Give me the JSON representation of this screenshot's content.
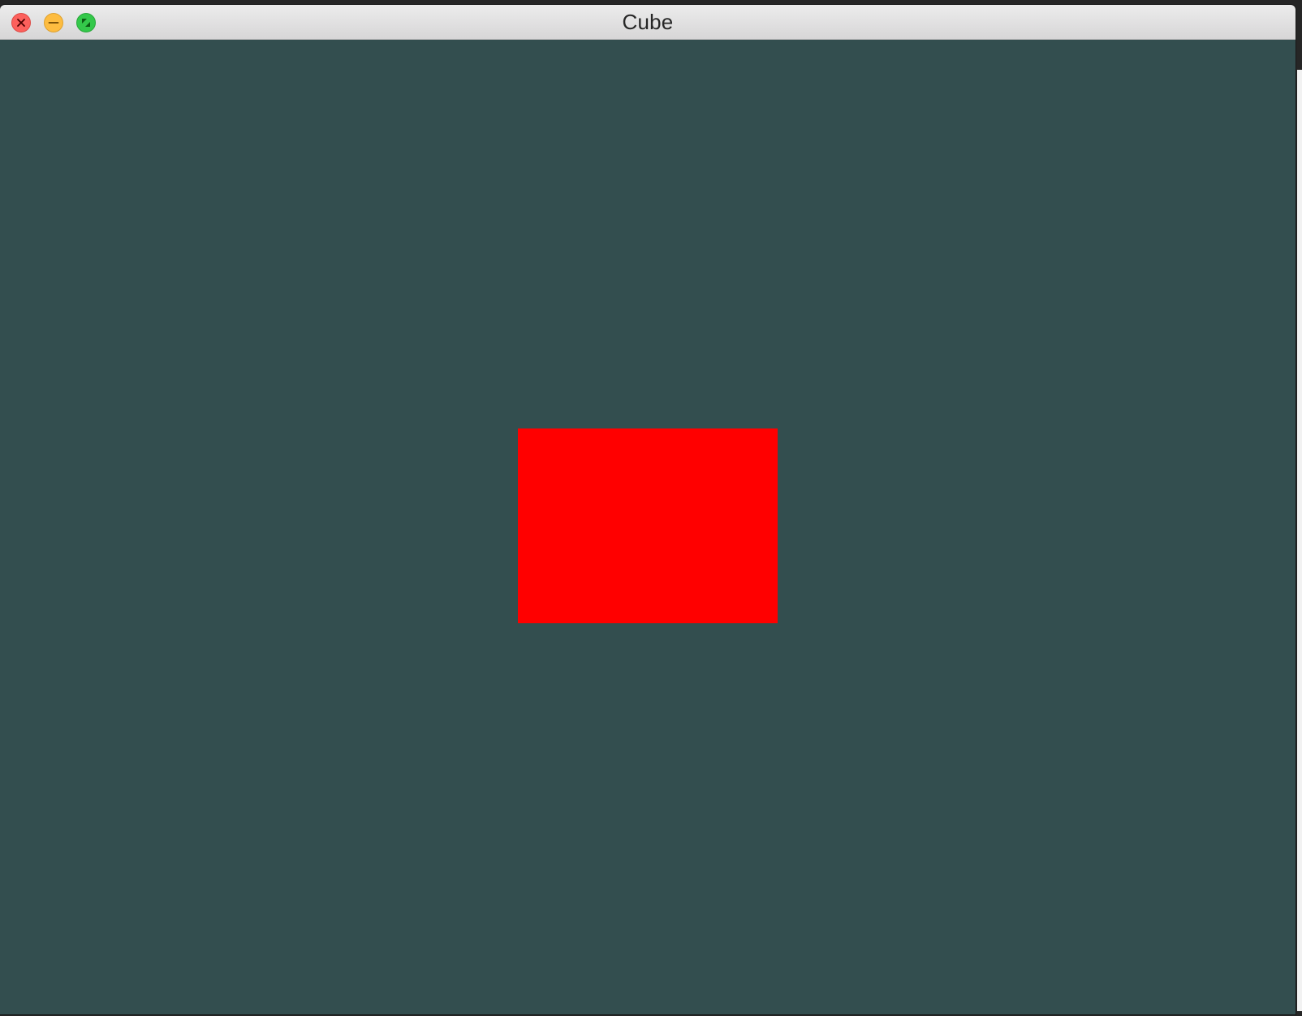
{
  "window": {
    "title": "Cube"
  },
  "controls": {
    "close_icon": "close-icon",
    "minimize_icon": "minimize-icon",
    "zoom_icon": "fullscreen-icon"
  },
  "scene": {
    "background_color": "#334e4f",
    "cube_color": "#ff0000"
  }
}
